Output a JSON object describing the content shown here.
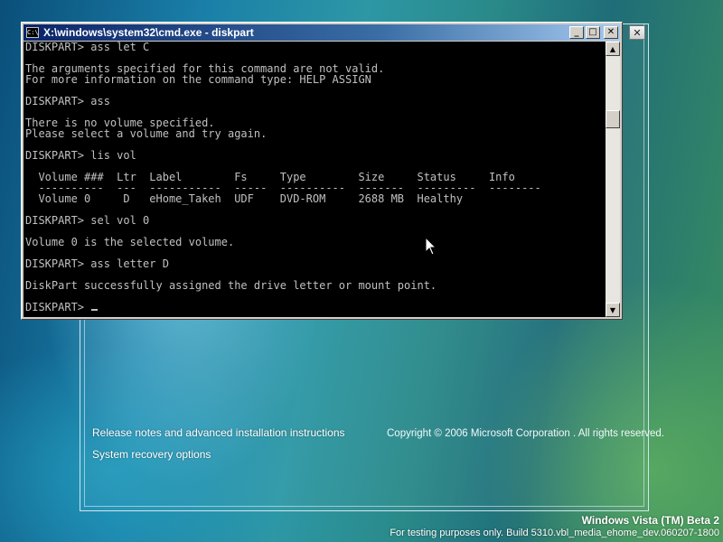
{
  "setup": {
    "close_label": "✕",
    "link_release_notes": "Release notes and advanced installation instructions",
    "link_recovery": "System recovery options",
    "copyright": "Copyright © 2006 Microsoft Corporation . All rights reserved."
  },
  "cmd": {
    "title": "X:\\windows\\system32\\cmd.exe - diskpart",
    "icon_text": "C:\\",
    "min_label": "_",
    "max_label": "□",
    "close_label": "✕",
    "lines": [
      "DISKPART> ass let C",
      "",
      "The arguments specified for this command are not valid.",
      "For more information on the command type: HELP ASSIGN",
      "",
      "DISKPART> ass",
      "",
      "There is no volume specified.",
      "Please select a volume and try again.",
      "",
      "DISKPART> lis vol",
      "",
      "  Volume ###  Ltr  Label        Fs     Type        Size     Status     Info",
      "  ----------  ---  -----------  -----  ----------  -------  ---------  --------",
      "  Volume 0     D   eHome_Takeh  UDF    DVD-ROM     2688 MB  Healthy",
      "",
      "DISKPART> sel vol 0",
      "",
      "Volume 0 is the selected volume.",
      "",
      "DISKPART> ass letter D",
      "",
      "DiskPart successfully assigned the drive letter or mount point.",
      "",
      "DISKPART> "
    ]
  },
  "footer": {
    "brand": "Windows Vista (TM) Beta 2",
    "build": "For testing purposes only. Build 5310.vbl_media_ehome_dev.060207-1800"
  },
  "colors": {
    "console_bg": "#000000",
    "console_fg": "#c0c0c0",
    "titlebar_active": "#0a246a"
  }
}
